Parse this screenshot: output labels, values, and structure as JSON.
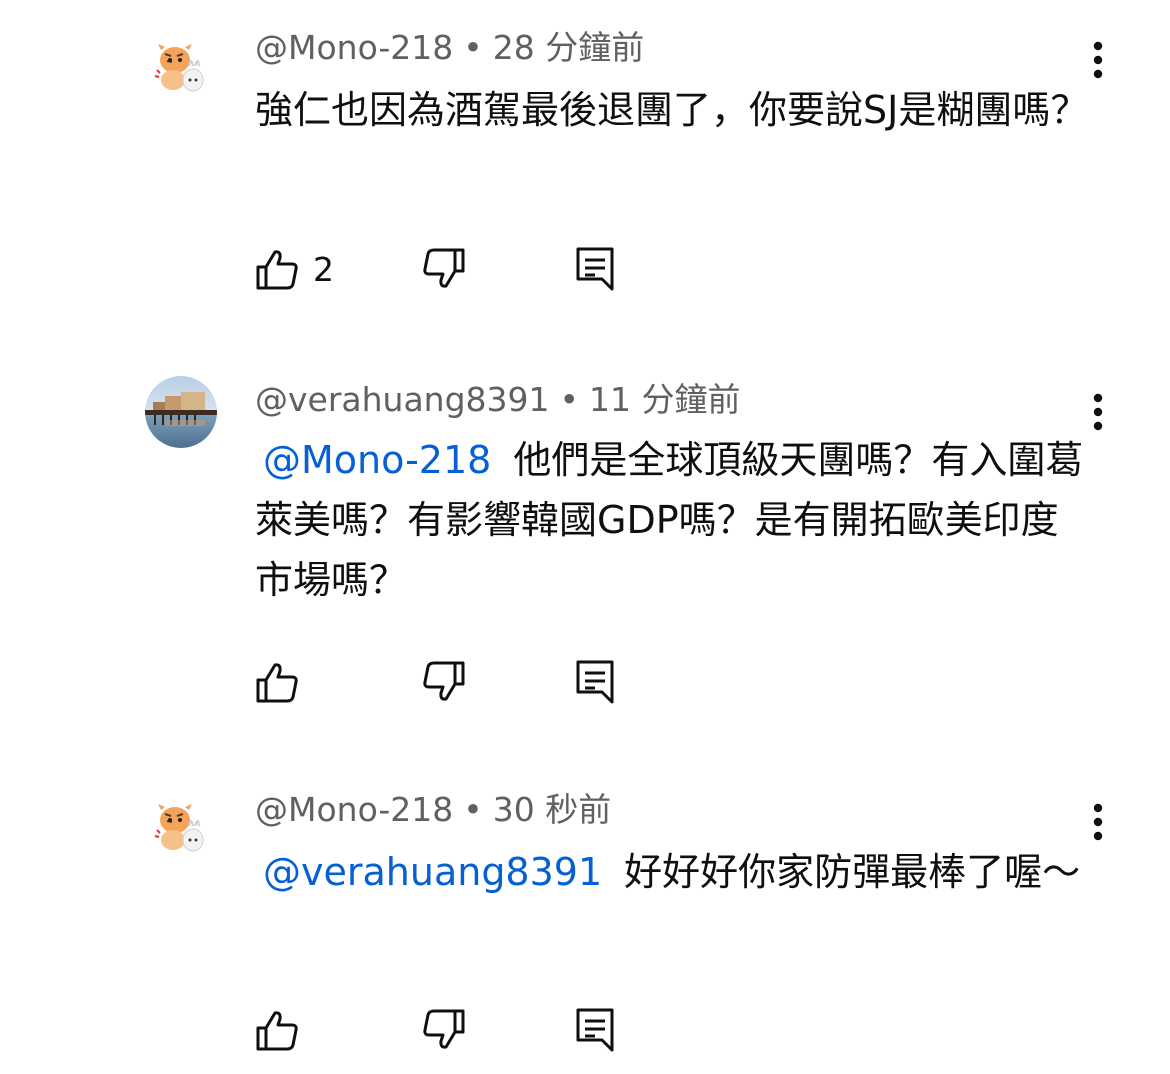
{
  "comments": [
    {
      "author": "@Mono-218",
      "separator": "•",
      "time": "28 分鐘前",
      "mention": "",
      "text": "強仁也因為酒駕最後退團了，你要說SJ是糊團嗎？",
      "likes": "2",
      "avatar_icon": "tiger-rabbit-cartoon-avatar"
    },
    {
      "author": "@verahuang8391",
      "separator": "•",
      "time": "11 分鐘前",
      "mention": "@Mono-218",
      "text": "他們是全球頂級天團嗎？有入圍葛萊美嗎？有影響韓國GDP嗎？是有開拓歐美印度市場嗎？",
      "likes": "",
      "avatar_icon": "harbor-photo-avatar"
    },
    {
      "author": "@Mono-218",
      "separator": "•",
      "time": "30 秒前",
      "mention": "@verahuang8391",
      "text": "好好好你家防彈最棒了喔～",
      "likes": "",
      "avatar_icon": "tiger-rabbit-cartoon-avatar"
    }
  ],
  "icons": {
    "like": "thumbs-up-icon",
    "dislike": "thumbs-down-icon",
    "reply": "reply-comment-icon",
    "more": "more-vertical-icon"
  },
  "colors": {
    "mention": "#065fd4",
    "meta": "#606060",
    "text": "#0f0f0f"
  }
}
